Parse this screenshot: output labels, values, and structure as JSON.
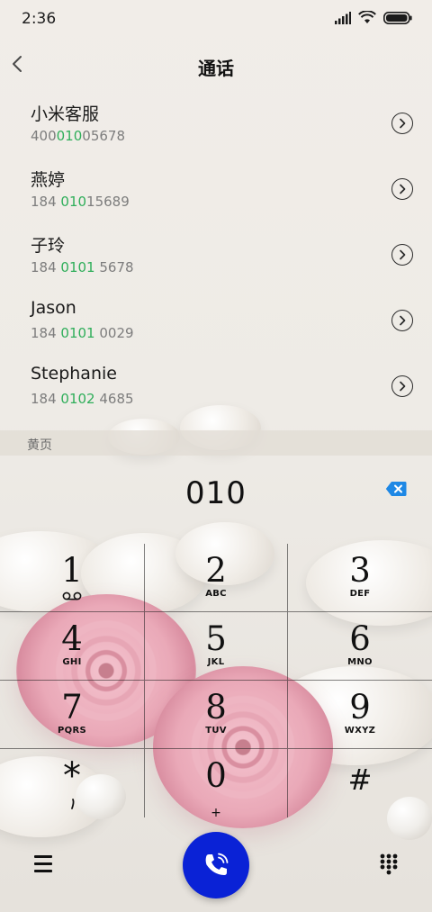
{
  "status": {
    "time": "2:36"
  },
  "header": {
    "title": "通话"
  },
  "contacts": [
    {
      "name": "小米客服",
      "number_pre": "400",
      "number_match": "010",
      "number_post": "05678"
    },
    {
      "name": "燕婷",
      "number_pre": "184 ",
      "number_match": "010",
      "number_post": "15689"
    },
    {
      "name": "子玲",
      "number_pre": "184 ",
      "number_match": "0101",
      "number_post": " 5678"
    },
    {
      "name": "Jason",
      "number_pre": "184 ",
      "number_match": "0101",
      "number_post": " 0029"
    },
    {
      "name": "Stephanie",
      "number_pre": "184 ",
      "number_match": "0102",
      "number_post": " 4685"
    }
  ],
  "section": {
    "label": "黄页"
  },
  "dialer": {
    "entered_number": "010"
  },
  "keypad": [
    {
      "digit": "1",
      "letters": ""
    },
    {
      "digit": "2",
      "letters": "ABC"
    },
    {
      "digit": "3",
      "letters": "DEF"
    },
    {
      "digit": "4",
      "letters": "GHI"
    },
    {
      "digit": "5",
      "letters": "JKL"
    },
    {
      "digit": "6",
      "letters": "MNO"
    },
    {
      "digit": "7",
      "letters": "PQRS"
    },
    {
      "digit": "8",
      "letters": "TUV"
    },
    {
      "digit": "9",
      "letters": "WXYZ"
    },
    {
      "digit": "*",
      "letters": ""
    },
    {
      "digit": "0",
      "letters": "+"
    },
    {
      "digit": "#",
      "letters": ""
    }
  ],
  "colors": {
    "accent_call": "#0a22d6",
    "match_highlight": "#2fae5a",
    "delete_blue": "#1e88e5"
  },
  "icons": {
    "back": "back-chevron-icon",
    "detail": "chevron-right-circle-icon",
    "delete": "backspace-icon",
    "voicemail": "voicemail-icon",
    "menu": "hamburger-menu-icon",
    "call": "phone-icon",
    "keypad": "dialpad-icon"
  }
}
